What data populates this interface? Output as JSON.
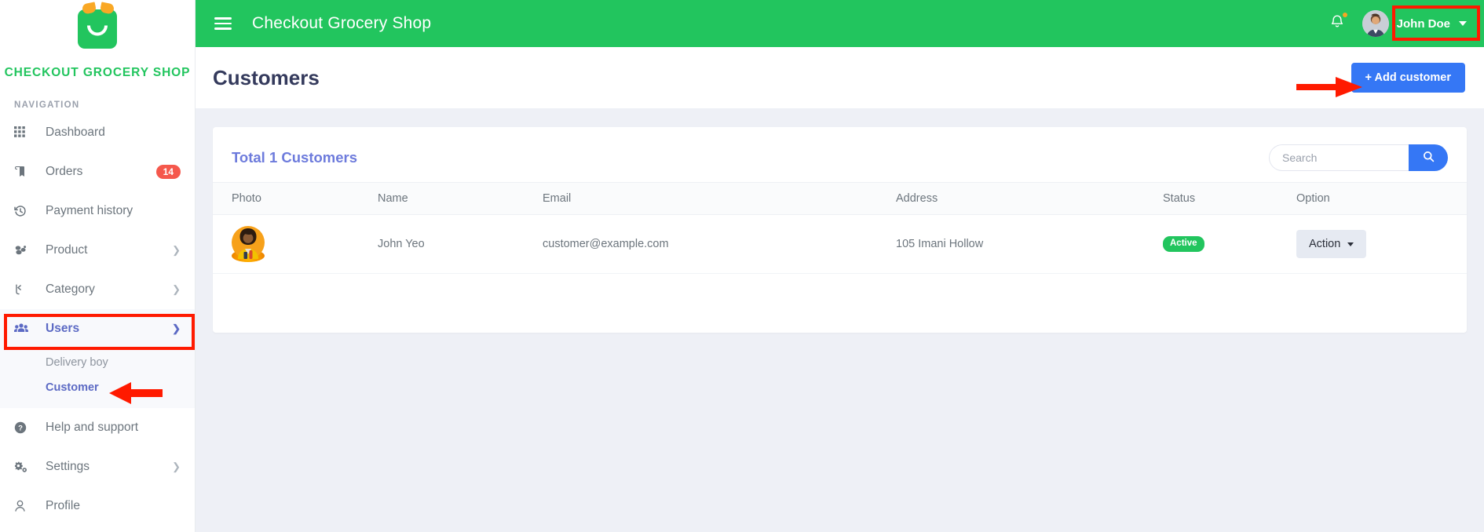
{
  "brand": {
    "logo_icon": "grocery-basket-logo",
    "name": "CHECKOUT GROCERY SHOP"
  },
  "sidebar": {
    "nav_heading": "NAVIGATION",
    "items": [
      {
        "label": "Dashboard",
        "icon": "grid-icon",
        "badge": null,
        "chevron": null
      },
      {
        "label": "Orders",
        "icon": "book-icon",
        "badge": "14",
        "chevron": null
      },
      {
        "label": "Payment history",
        "icon": "history-icon",
        "badge": null,
        "chevron": null
      },
      {
        "label": "Product",
        "icon": "boxes-icon",
        "badge": null,
        "chevron": "right"
      },
      {
        "label": "Category",
        "icon": "sitemap-icon",
        "badge": null,
        "chevron": "right"
      },
      {
        "label": "Users",
        "icon": "users-icon",
        "badge": null,
        "chevron": "down"
      },
      {
        "label": "Help and support",
        "icon": "question-mark-icon",
        "badge": null,
        "chevron": null
      },
      {
        "label": "Settings",
        "icon": "gears-icon",
        "badge": null,
        "chevron": "right"
      },
      {
        "label": "Profile",
        "icon": "user-icon",
        "badge": null,
        "chevron": null
      }
    ],
    "submenu": [
      {
        "label": "Delivery boy",
        "active": false
      },
      {
        "label": "Customer",
        "active": true
      }
    ]
  },
  "topbar": {
    "menu_icon": "hamburger-icon",
    "title": "Checkout Grocery Shop",
    "bell_icon": "bell-icon",
    "user_name": "John Doe",
    "avatar_icon": "user-avatar"
  },
  "page": {
    "title": "Customers",
    "add_button_label": "+ Add customer"
  },
  "card": {
    "title": "Total 1 Customers",
    "search": {
      "placeholder": "Search",
      "value": "",
      "button_icon": "search-icon"
    },
    "columns": [
      "Photo",
      "Name",
      "Email",
      "Address",
      "Status",
      "Option"
    ],
    "rows": [
      {
        "photo": "customer-avatar",
        "name": "John Yeo",
        "email": "customer@example.com",
        "address": "105 Imani Hollow",
        "status": "Active",
        "action_label": "Action"
      }
    ]
  },
  "colors": {
    "brand_green": "#22c55e",
    "accent_blue": "#3577f5",
    "indigo": "#5c6ac4",
    "card_title": "#6d7bdc",
    "badge_red": "#f5584c",
    "annotation_red": "#ff1a00",
    "page_bg": "#eef0f6"
  }
}
